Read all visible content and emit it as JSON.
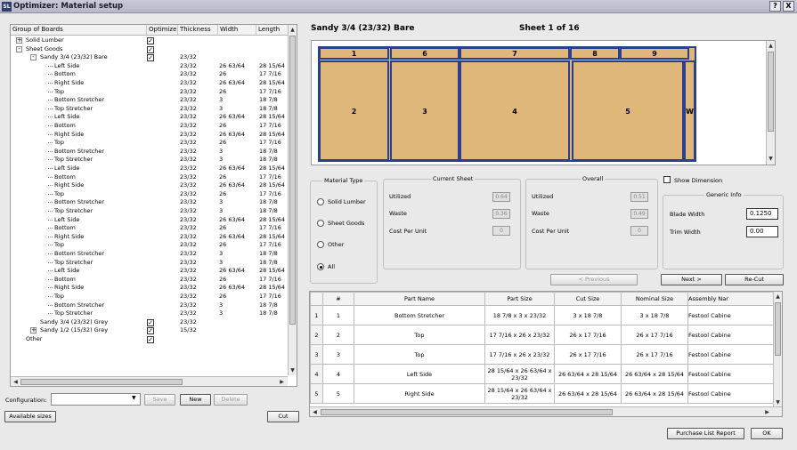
{
  "window": {
    "title": "Optimizer: Material setup",
    "icon": "SL",
    "help_btn": "?",
    "close_btn": "X"
  },
  "tree": {
    "columns": [
      "Group of Boards",
      "Optimize",
      "Thickness",
      "Width",
      "Length"
    ],
    "rows": [
      {
        "label": "Solid Lumber",
        "indent": 0,
        "exp": "+",
        "opt": true,
        "th": "",
        "w": "",
        "l": ""
      },
      {
        "label": "Sheet Goods",
        "indent": 0,
        "exp": "-",
        "opt": true,
        "th": "",
        "w": "",
        "l": ""
      },
      {
        "label": "Sandy 3/4 (23/32) Bare",
        "indent": 1,
        "exp": "-",
        "opt": true,
        "th": "23/32",
        "w": "",
        "l": ""
      },
      {
        "label": "Left Side",
        "indent": 2,
        "exp": "",
        "opt": null,
        "th": "23/32",
        "w": "26 63/64",
        "l": "28 15/64"
      },
      {
        "label": "Bottom",
        "indent": 2,
        "exp": "",
        "opt": null,
        "th": "23/32",
        "w": "26",
        "l": "17 7/16"
      },
      {
        "label": "Right Side",
        "indent": 2,
        "exp": "",
        "opt": null,
        "th": "23/32",
        "w": "26 63/64",
        "l": "28 15/64"
      },
      {
        "label": "Top",
        "indent": 2,
        "exp": "",
        "opt": null,
        "th": "23/32",
        "w": "26",
        "l": "17 7/16"
      },
      {
        "label": "Bottom Stretcher",
        "indent": 2,
        "exp": "",
        "opt": null,
        "th": "23/32",
        "w": "3",
        "l": "18 7/8"
      },
      {
        "label": "Top Stretcher",
        "indent": 2,
        "exp": "",
        "opt": null,
        "th": "23/32",
        "w": "3",
        "l": "18 7/8"
      },
      {
        "label": "Left Side",
        "indent": 2,
        "exp": "",
        "opt": null,
        "th": "23/32",
        "w": "26 63/64",
        "l": "28 15/64"
      },
      {
        "label": "Bottom",
        "indent": 2,
        "exp": "",
        "opt": null,
        "th": "23/32",
        "w": "26",
        "l": "17 7/16"
      },
      {
        "label": "Right Side",
        "indent": 2,
        "exp": "",
        "opt": null,
        "th": "23/32",
        "w": "26 63/64",
        "l": "28 15/64"
      },
      {
        "label": "Top",
        "indent": 2,
        "exp": "",
        "opt": null,
        "th": "23/32",
        "w": "26",
        "l": "17 7/16"
      },
      {
        "label": "Bottom Stretcher",
        "indent": 2,
        "exp": "",
        "opt": null,
        "th": "23/32",
        "w": "3",
        "l": "18 7/8"
      },
      {
        "label": "Top Stretcher",
        "indent": 2,
        "exp": "",
        "opt": null,
        "th": "23/32",
        "w": "3",
        "l": "18 7/8"
      },
      {
        "label": "Left Side",
        "indent": 2,
        "exp": "",
        "opt": null,
        "th": "23/32",
        "w": "26 63/64",
        "l": "28 15/64"
      },
      {
        "label": "Bottom",
        "indent": 2,
        "exp": "",
        "opt": null,
        "th": "23/32",
        "w": "26",
        "l": "17 7/16"
      },
      {
        "label": "Right Side",
        "indent": 2,
        "exp": "",
        "opt": null,
        "th": "23/32",
        "w": "26 63/64",
        "l": "28 15/64"
      },
      {
        "label": "Top",
        "indent": 2,
        "exp": "",
        "opt": null,
        "th": "23/32",
        "w": "26",
        "l": "17 7/16"
      },
      {
        "label": "Bottom Stretcher",
        "indent": 2,
        "exp": "",
        "opt": null,
        "th": "23/32",
        "w": "3",
        "l": "18 7/8"
      },
      {
        "label": "Top Stretcher",
        "indent": 2,
        "exp": "",
        "opt": null,
        "th": "23/32",
        "w": "3",
        "l": "18 7/8"
      },
      {
        "label": "Left Side",
        "indent": 2,
        "exp": "",
        "opt": null,
        "th": "23/32",
        "w": "26 63/64",
        "l": "28 15/64"
      },
      {
        "label": "Bottom",
        "indent": 2,
        "exp": "",
        "opt": null,
        "th": "23/32",
        "w": "26",
        "l": "17 7/16"
      },
      {
        "label": "Right Side",
        "indent": 2,
        "exp": "",
        "opt": null,
        "th": "23/32",
        "w": "26 63/64",
        "l": "28 15/64"
      },
      {
        "label": "Top",
        "indent": 2,
        "exp": "",
        "opt": null,
        "th": "23/32",
        "w": "26",
        "l": "17 7/16"
      },
      {
        "label": "Bottom Stretcher",
        "indent": 2,
        "exp": "",
        "opt": null,
        "th": "23/32",
        "w": "3",
        "l": "18 7/8"
      },
      {
        "label": "Top Stretcher",
        "indent": 2,
        "exp": "",
        "opt": null,
        "th": "23/32",
        "w": "3",
        "l": "18 7/8"
      },
      {
        "label": "Left Side",
        "indent": 2,
        "exp": "",
        "opt": null,
        "th": "23/32",
        "w": "26 63/64",
        "l": "28 15/64"
      },
      {
        "label": "Bottom",
        "indent": 2,
        "exp": "",
        "opt": null,
        "th": "23/32",
        "w": "26",
        "l": "17 7/16"
      },
      {
        "label": "Right Side",
        "indent": 2,
        "exp": "",
        "opt": null,
        "th": "23/32",
        "w": "26 63/64",
        "l": "28 15/64"
      },
      {
        "label": "Top",
        "indent": 2,
        "exp": "",
        "opt": null,
        "th": "23/32",
        "w": "26",
        "l": "17 7/16"
      },
      {
        "label": "Bottom Stretcher",
        "indent": 2,
        "exp": "",
        "opt": null,
        "th": "23/32",
        "w": "3",
        "l": "18 7/8"
      },
      {
        "label": "Top Stretcher",
        "indent": 2,
        "exp": "",
        "opt": null,
        "th": "23/32",
        "w": "3",
        "l": "18 7/8"
      },
      {
        "label": "Sandy 3/4 (23/32) Grey",
        "indent": 1,
        "exp": "",
        "opt": true,
        "th": "23/32",
        "w": "",
        "l": ""
      },
      {
        "label": "Sandy 1/2 (15/32) Grey",
        "indent": 1,
        "exp": "+",
        "opt": true,
        "th": "15/32",
        "w": "",
        "l": ""
      },
      {
        "label": "Other",
        "indent": 0,
        "exp": "",
        "opt": true,
        "th": "",
        "w": "",
        "l": ""
      }
    ]
  },
  "config": {
    "label": "Configuration:",
    "value": "",
    "save": "Save",
    "new": "New",
    "delete": "Delete",
    "available": "Available sizes",
    "cut": "Cut"
  },
  "sheet": {
    "material": "Sandy 3/4 (23/32) Bare",
    "page": "Sheet 1 of 16",
    "top_strip": [
      "1",
      "6",
      "7",
      "8",
      "9"
    ],
    "main_pieces": [
      "2",
      "3",
      "4",
      "5",
      "W"
    ]
  },
  "material_type": {
    "title": "Material Type",
    "options": [
      "Solid Lumber",
      "Sheet Goods",
      "Other",
      "All"
    ],
    "selected": "All"
  },
  "current_sheet": {
    "title": "Current Sheet",
    "utilized_label": "Utilized",
    "utilized": "0.64",
    "waste_label": "Waste",
    "waste": "0.36",
    "cpu_label": "Cost Per Unit",
    "cpu": "0"
  },
  "overall": {
    "title": "Overall",
    "utilized_label": "Utilized",
    "utilized": "0.51",
    "waste_label": "Waste",
    "waste": "0.49",
    "cpu_label": "Cost Per Unit",
    "cpu": "0"
  },
  "show_dimension": "Show Dimension",
  "generic": {
    "title": "Generic Info",
    "blade_label": "Blade Width",
    "blade": "0.1250",
    "trim_label": "Trim Width",
    "trim": "0.00"
  },
  "nav": {
    "prev": "< Previous",
    "next": "Next >",
    "recut": "Re-Cut"
  },
  "parts": {
    "columns": [
      "#",
      "Part Name",
      "Part Size",
      "Cut Size",
      "Nominal Size",
      "Assembly Nar"
    ],
    "rows": [
      {
        "rh": "1",
        "n": "1",
        "name": "Bottom Stretcher",
        "size": "18 7/8 x 3 x 23/32",
        "cut": "3 x 18 7/8",
        "nom": "3 x 18 7/8",
        "asm": "Festool Cabine"
      },
      {
        "rh": "2",
        "n": "2",
        "name": "Top",
        "size": "17 7/16 x 26 x 23/32",
        "cut": "26 x 17 7/16",
        "nom": "26 x 17 7/16",
        "asm": "Festool Cabine"
      },
      {
        "rh": "3",
        "n": "3",
        "name": "Top",
        "size": "17 7/16 x 26 x 23/32",
        "cut": "26 x 17 7/16",
        "nom": "26 x 17 7/16",
        "asm": "Festool Cabine"
      },
      {
        "rh": "4",
        "n": "4",
        "name": "Left Side",
        "size": "28 15/64 x 26 63/64 x 23/32",
        "cut": "26 63/64 x 28 15/64",
        "nom": "26 63/64 x 28 15/64",
        "asm": "Festool Cabine"
      },
      {
        "rh": "5",
        "n": "5",
        "name": "Right Side",
        "size": "28 15/64 x 26 63/64 x 23/32",
        "cut": "26 63/64 x 28 15/64",
        "nom": "26 63/64 x 28 15/64",
        "asm": "Festool Cabine"
      }
    ]
  },
  "footer": {
    "report": "Purchase List Report",
    "ok": "OK"
  }
}
